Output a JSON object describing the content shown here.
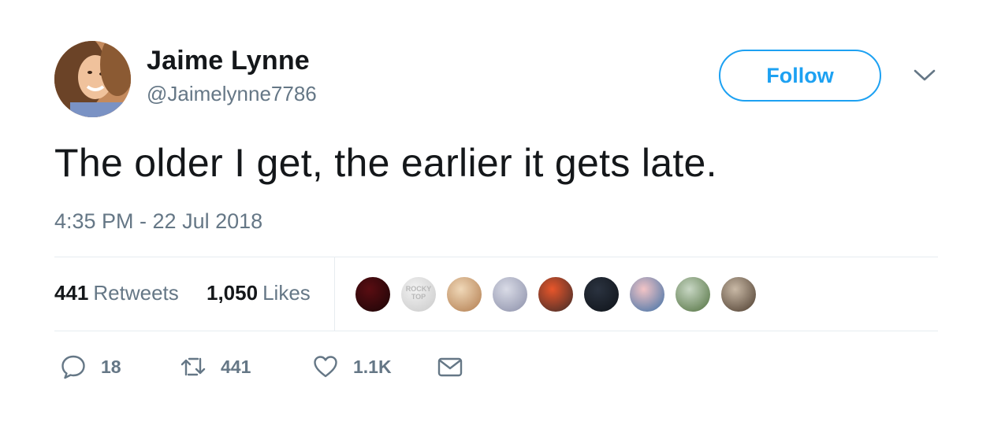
{
  "user": {
    "display_name": "Jaime Lynne",
    "handle": "@Jaimelynne7786"
  },
  "follow_label": "Follow",
  "tweet": {
    "text": "The older I get, the earlier it gets late.",
    "timestamp": "4:35 PM - 22 Jul 2018"
  },
  "stats": {
    "retweets_count": "441",
    "retweets_label": "Retweets",
    "likes_count": "1,050",
    "likes_label": "Likes"
  },
  "likers": [
    {
      "color_a": "#5a0d12",
      "color_b": "#1a0507"
    },
    {
      "color_a": "#f2f2f2",
      "color_b": "#c9c9c9",
      "text": "ROCKY TOP"
    },
    {
      "color_a": "#f0d8b8",
      "color_b": "#b07a4c"
    },
    {
      "color_a": "#d9dbe6",
      "color_b": "#8a8ea8"
    },
    {
      "color_a": "#e8562b",
      "color_b": "#3b2a28"
    },
    {
      "color_a": "#2b3340",
      "color_b": "#0e1218"
    },
    {
      "color_a": "#f3c4c6",
      "color_b": "#3a6ea5"
    },
    {
      "color_a": "#c8d7c4",
      "color_b": "#4f6f3d"
    },
    {
      "color_a": "#c9b9a6",
      "color_b": "#4a3a2c"
    }
  ],
  "actions": {
    "reply_count": "18",
    "retweet_count": "441",
    "like_count": "1.1K"
  },
  "colors": {
    "accent": "#1da1f2",
    "secondary_text": "#657786",
    "divider": "#e6ecf0"
  }
}
